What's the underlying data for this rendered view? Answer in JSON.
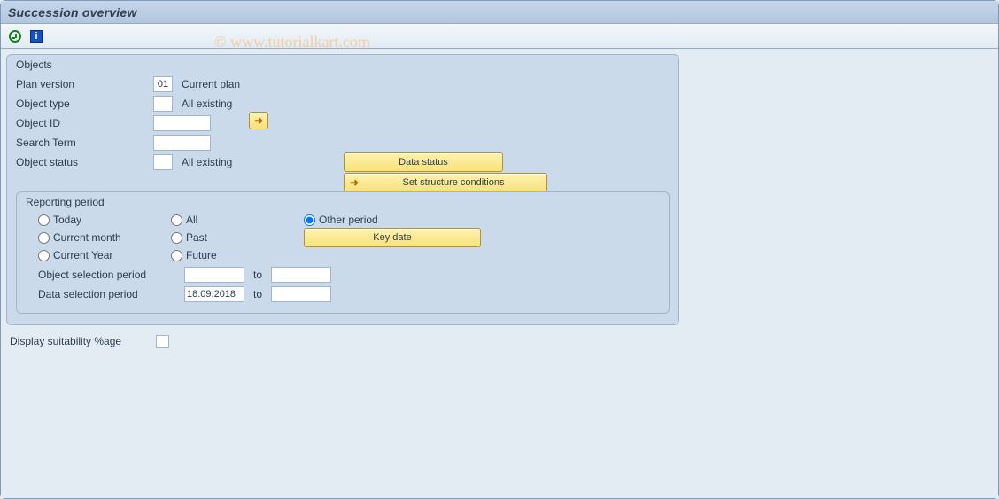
{
  "header": {
    "title": "Succession overview"
  },
  "toolbar": {
    "execute_tip": "Execute",
    "info_tip": "Information"
  },
  "watermark": "© www.tutorialkart.com",
  "objects": {
    "group_title": "Objects",
    "plan_version": {
      "label": "Plan version",
      "value": "01",
      "desc": "Current plan"
    },
    "object_type": {
      "label": "Object type",
      "value": "",
      "desc": "All existing"
    },
    "object_id": {
      "label": "Object ID",
      "value": ""
    },
    "search_term": {
      "label": "Search Term",
      "value": ""
    },
    "object_status": {
      "label": "Object status",
      "value": "",
      "desc": "All existing"
    },
    "buttons": {
      "data_status": "Data status",
      "set_structure": "Set structure conditions"
    }
  },
  "reporting": {
    "group_title": "Reporting period",
    "radios": {
      "today": "Today",
      "all": "All",
      "other": "Other period",
      "current_month": "Current month",
      "past": "Past",
      "current_year": "Current Year",
      "future": "Future",
      "selected": "other"
    },
    "key_date_label": "Key date",
    "obj_sel_period": {
      "label": "Object selection period",
      "from": "",
      "to_label": "to",
      "to": ""
    },
    "data_sel_period": {
      "label": "Data selection period",
      "from": "18.09.2018",
      "to_label": "to",
      "to": ""
    }
  },
  "display_suitability": {
    "label": "Display suitability %age",
    "checked": false
  }
}
